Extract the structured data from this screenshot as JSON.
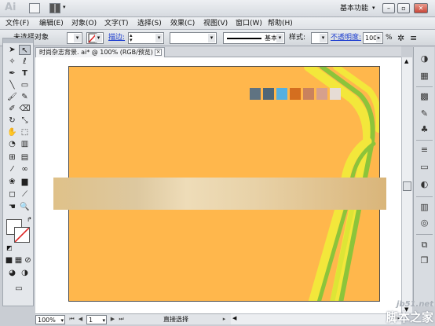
{
  "app": {
    "logo": "Ai",
    "workspace": "基本功能"
  },
  "menu": [
    "文件(F)",
    "编辑(E)",
    "对象(O)",
    "文字(T)",
    "选择(S)",
    "效果(C)",
    "视图(V)",
    "窗口(W)",
    "帮助(H)"
  ],
  "control": {
    "no_selection": "未选择对象",
    "stroke_label": "描边:",
    "stroke_style": "基本",
    "style_label": "样式:",
    "opacity_label": "不透明度:",
    "opacity_value": "100",
    "opacity_unit": "%"
  },
  "document": {
    "tab_title": "时尚杂志背景. ai* @ 100% (RGB/预览)",
    "close_glyph": "×"
  },
  "status": {
    "zoom": "100%",
    "page": "1",
    "tool": "直接选择"
  },
  "swatches": [
    "#5f7382",
    "#4e6677",
    "#55b0e0",
    "#d46e1f",
    "#c9825d",
    "#d6a08d",
    "#ddcdc4"
  ],
  "colors": {
    "artboard": "#ffb74c",
    "green": "#8ac43a",
    "yellow": "#f4ee3d"
  },
  "watermark": {
    "site": "jb51.net",
    "name": "脚本之家"
  },
  "icons": {
    "tools": [
      "selection-icon",
      "direct-selection-icon",
      "magic-wand-icon",
      "lasso-icon",
      "pen-icon",
      "type-icon",
      "line-icon",
      "rectangle-icon",
      "paintbrush-icon",
      "pencil-icon",
      "blob-brush-icon",
      "eraser-icon",
      "rotate-icon",
      "scale-icon",
      "warp-icon",
      "free-transform-icon",
      "shape-builder-icon",
      "perspective-icon",
      "mesh-icon",
      "gradient-icon",
      "eyedropper-icon",
      "blend-icon",
      "symbol-sprayer-icon",
      "column-graph-icon",
      "artboard-icon",
      "slice-icon",
      "hand-icon",
      "zoom-icon"
    ]
  }
}
